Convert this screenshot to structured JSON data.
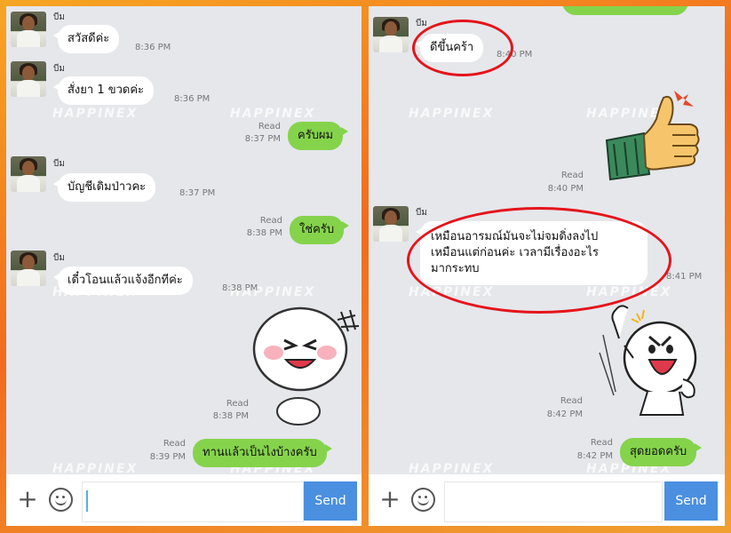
{
  "watermark": "HAPPINEX",
  "composer": {
    "send_label": "Send",
    "plus_icon": "plus-icon",
    "emoji_icon": "emoji-icon"
  },
  "left": {
    "messages": [
      {
        "sender": "บีม",
        "text": "สวัสดีค่ะ",
        "time": "8:36 PM"
      },
      {
        "sender": "บีม",
        "text": "สั่งยา 1 ขวดค่ะ",
        "time": "8:36 PM"
      },
      {
        "text": "ครับผม",
        "read": "Read",
        "time": "8:37 PM"
      },
      {
        "sender": "บีม",
        "text": "บัญชีเดิมป่าวคะ",
        "time": "8:37 PM"
      },
      {
        "text": "ใช่ครับ",
        "read": "Read",
        "time": "8:38 PM"
      },
      {
        "sender": "บีม",
        "text": "เดี๋วโอนแล้วแจ้งอีกทีค่ะ",
        "time": "8:38 PM"
      },
      {
        "sticker": "laughing-bun-sticker",
        "read": "Read",
        "time": "8:38 PM"
      },
      {
        "text": "ทานแล้วเป็นไงบ้างครับ",
        "read": "Read",
        "time": "8:39 PM"
      }
    ]
  },
  "right": {
    "messages": [
      {
        "sender": "บีม",
        "text": "ดีขึ้นคร้า",
        "time": "8:40 PM"
      },
      {
        "sticker": "thumbs-up-sticker",
        "read": "Read",
        "time": "8:40 PM"
      },
      {
        "sender": "บีม",
        "line1": "เหมือนอารมณ์มันจะไม่จมดิ่งลงไป",
        "line2": "เหมือนแต่ก่อนค่ะ เวลามีเรื่องอะไร",
        "line3": "มากระทบ",
        "time": "8:41 PM"
      },
      {
        "sticker": "cheering-bun-sticker",
        "read": "Read",
        "time": "8:42 PM"
      },
      {
        "text": "สุดยอดครับ",
        "read": "Read",
        "time": "8:42 PM"
      }
    ]
  },
  "colors": {
    "outgoing_bubble": "#85d34b",
    "incoming_bubble": "#ffffff",
    "send_button": "#4a8fe0",
    "highlight_ring": "#e5141b"
  }
}
